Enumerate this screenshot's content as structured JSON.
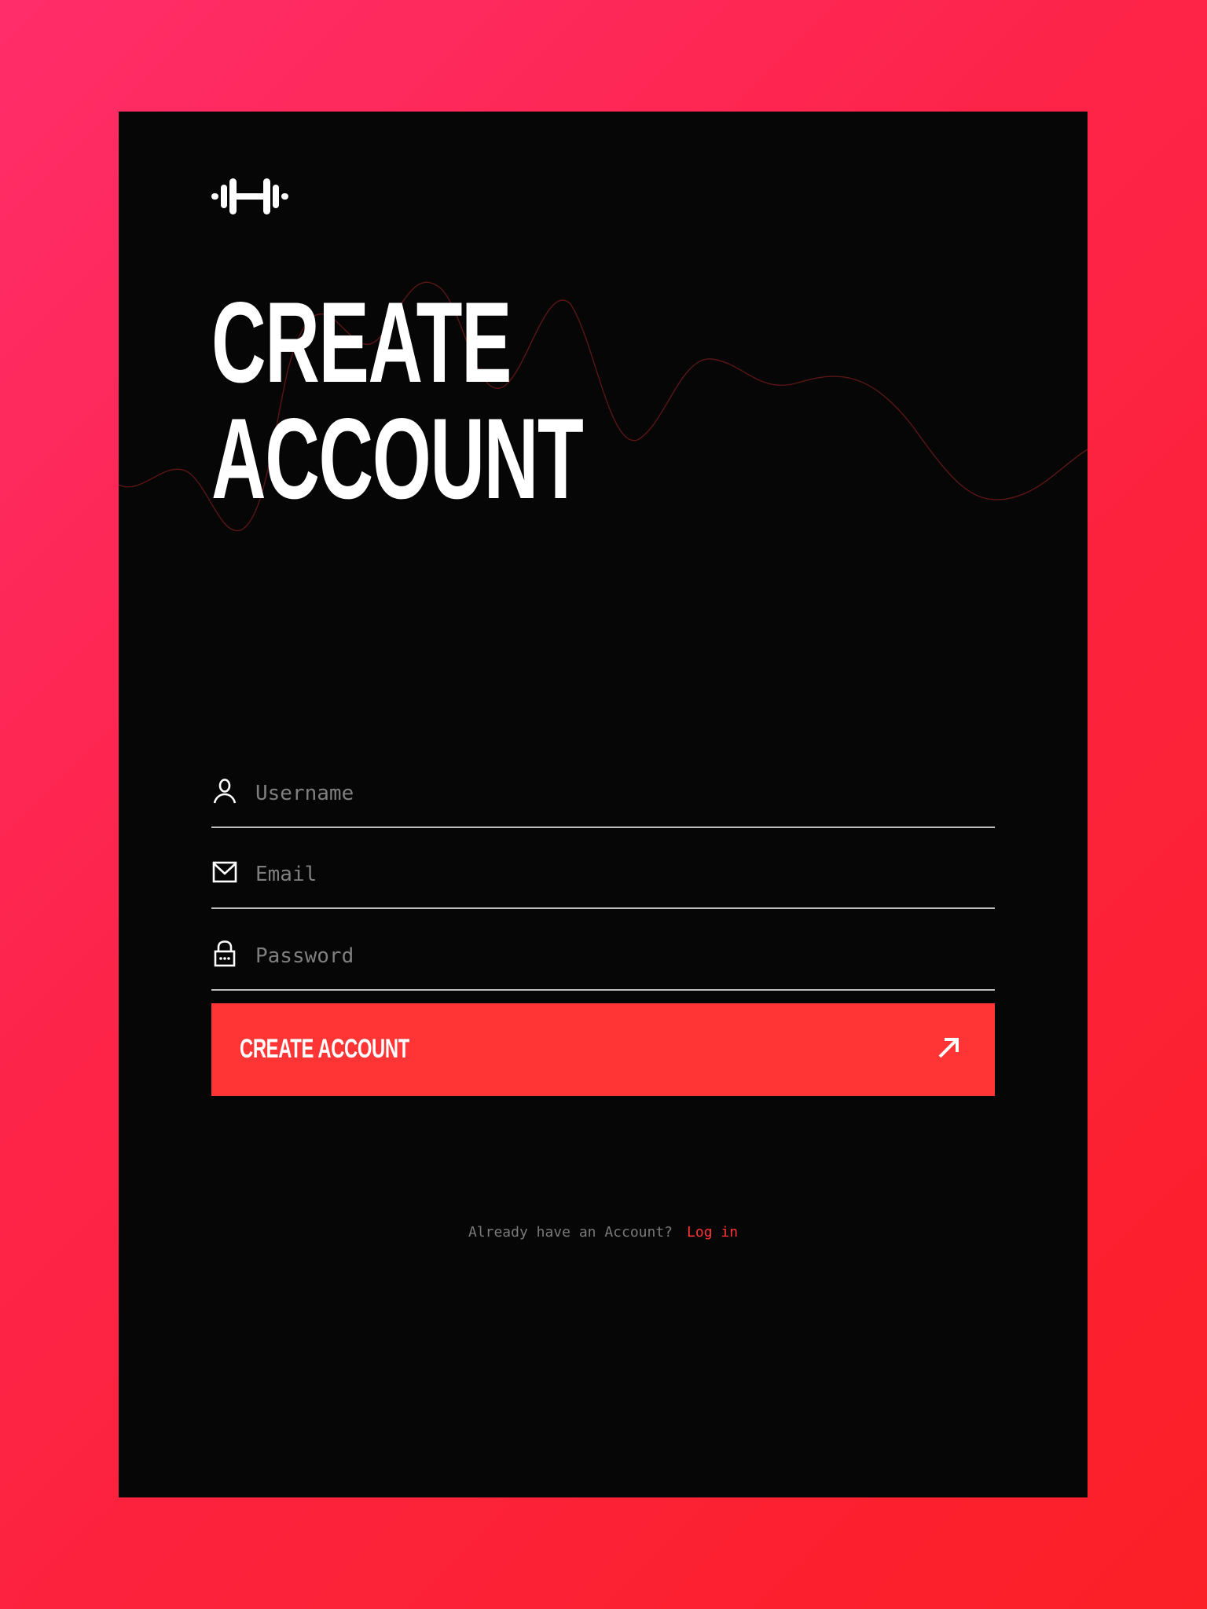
{
  "colors": {
    "background_gradient": [
      "#ff2d6a",
      "#fb1f26"
    ],
    "card": "#060606",
    "accent": "#ff3535",
    "text": "#ffffff",
    "muted": "#7a7a7a",
    "field_line": "#bdbdbd",
    "wave_line": "#5a1616"
  },
  "logo": {
    "icon": "dumbbell-icon"
  },
  "heading": {
    "line1": "CREATE",
    "line2": "ACCOUNT"
  },
  "form": {
    "username": {
      "icon": "user-icon",
      "placeholder": "Username",
      "value": ""
    },
    "email": {
      "icon": "mail-icon",
      "placeholder": "Email",
      "value": ""
    },
    "password": {
      "icon": "lock-icon",
      "placeholder": "Password",
      "value": ""
    }
  },
  "submit": {
    "label": "CREATE ACCOUNT",
    "icon": "arrow-up-right-icon"
  },
  "footer": {
    "prompt": "Already have an Account?",
    "link": "Log in"
  }
}
